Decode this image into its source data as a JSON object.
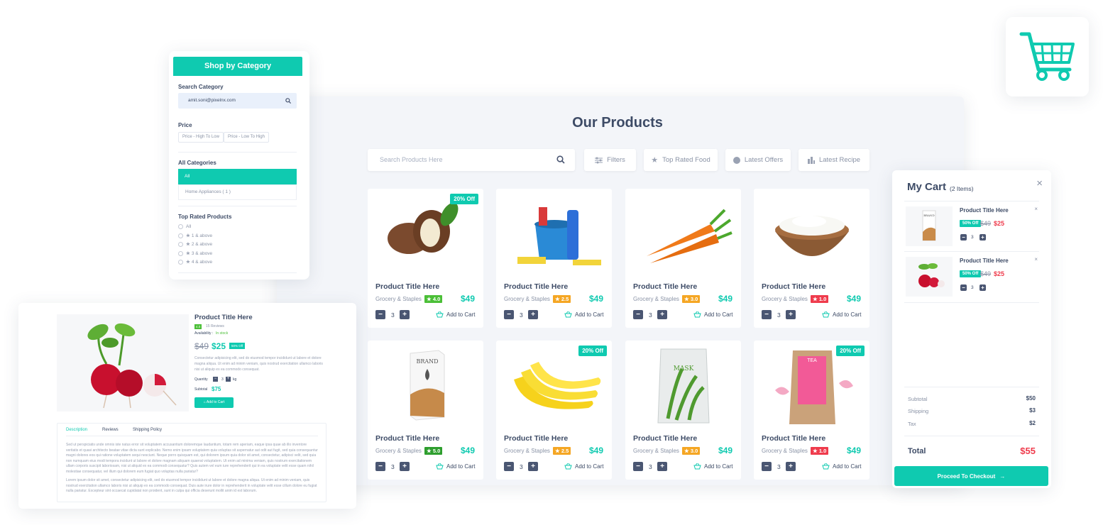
{
  "main": {
    "title": "Our Products",
    "search_placeholder": "Search Products Here",
    "filters": [
      "Filters",
      "Top Rated Food",
      "Latest Offers",
      "Latest Recipe"
    ],
    "products": [
      {
        "title": "Product Title Here",
        "category": "Grocery & Staples",
        "rating": "4.0",
        "price": "$49",
        "qty": "3",
        "add": "Add to Cart",
        "tag": "20% Off",
        "image": "argan-nut",
        "rating_color": "#4bbf37"
      },
      {
        "title": "Product Title Here",
        "category": "Grocery & Staples",
        "rating": "2.5",
        "price": "$49",
        "qty": "3",
        "add": "Add to Cart",
        "tag": "",
        "image": "cleaning-bucket",
        "rating_color": "#f5a623"
      },
      {
        "title": "Product Title Here",
        "category": "Grocery & Staples",
        "rating": "3.0",
        "price": "$49",
        "qty": "3",
        "add": "Add to Cart",
        "tag": "",
        "image": "carrots",
        "rating_color": "#f5a623"
      },
      {
        "title": "Product Title Here",
        "category": "Grocery & Staples",
        "rating": "1.0",
        "price": "$49",
        "qty": "3",
        "add": "Add to Cart",
        "tag": "",
        "image": "yogurt-bowl",
        "rating_color": "#ef3b4c"
      },
      {
        "title": "Product Title Here",
        "category": "Grocery & Staples",
        "rating": "5.0",
        "price": "$49",
        "qty": "3",
        "add": "Add to Cart",
        "tag": "",
        "image": "brand-box",
        "rating_color": "#2e9e2e"
      },
      {
        "title": "Product Title Here",
        "category": "Grocery & Staples",
        "rating": "2.5",
        "price": "$49",
        "qty": "3",
        "add": "Add to Cart",
        "tag": "20% Off",
        "image": "bananas",
        "rating_color": "#f5a623"
      },
      {
        "title": "Product Title Here",
        "category": "Grocery & Staples",
        "rating": "3.0",
        "price": "$49",
        "qty": "3",
        "add": "Add to Cart",
        "tag": "",
        "image": "aloe-mask",
        "rating_color": "#f5a623"
      },
      {
        "title": "Product Title Here",
        "category": "Grocery & Staples",
        "rating": "1.0",
        "price": "$49",
        "qty": "3",
        "add": "Add to Cart",
        "tag": "20% Off",
        "image": "tea-bag",
        "rating_color": "#ef3b4c"
      }
    ]
  },
  "sidebar": {
    "title": "Shop by Category",
    "search_label": "Search Category",
    "search_value": "amit.soni@pixelnx.com",
    "price_label": "Price",
    "price_options": [
      "Price - High To Low",
      "Price - Low To High"
    ],
    "categories_label": "All Categories",
    "categories": [
      "All",
      "Home Appliances ( 1 )"
    ],
    "rated_label": "Top Rated Products",
    "rated_options": [
      "All",
      "1 & above",
      "2 & above",
      "3 & above",
      "4 & above"
    ]
  },
  "detail": {
    "title": "Product Title Here",
    "rating": "4.0",
    "reviews": "15 Reviews",
    "availability_label": "Availability :",
    "availability": "In stock",
    "old_price": "$49",
    "new_price": "$25",
    "badge": "50% Off",
    "description": "Consectetur adipisicing elit, sed do eiusmod tempor incididunt ut labore et dolore magna aliqua. Ut enim ad minim veniam, quis nostrud exercitation ullamco laboris nisi ut aliquip ex ea commodo consequat.",
    "quantity_label": "Quantity",
    "qty": "3",
    "unit": "kg",
    "subtotal_label": "Subtotal",
    "subtotal": "$75",
    "add": "Add to Cart",
    "tabs": [
      "Description",
      "Reviews",
      "Shipping Policy"
    ],
    "text1": "Sed ut perspiciatis unde omnis iste natus error sit voluptatem accusantium doloremque laudantium, totam rem aperiam, eaque ipsa quae ab illo inventore veritatis et quasi architecto beatae vitae dicta sunt explicabo. Nemo enim ipsam voluptatem quia voluptas sit aspernatur aut odit aut fugit, sed quia consequuntur magni dolores eos qui ratione voluptatem sequi nesciunt. Neque porro quisquam est, qui dolorem ipsum quia dolor sit amet, consectetur, adipisci velit, sed quia non numquam eius modi tempora incidunt ut labore et dolore magnam aliquam quaerat voluptatem. Ut enim ad minima veniam, quis nostrum exercitationem ullam corporis suscipit laboriosam, nisi ut aliquid ex ea commodi consequatur? Quis autem vel eum iure reprehenderit qui in ea voluptate velit esse quam nihil molestiae consequatur, vel illum qui dolorem eum fugiat quo voluptas nulla pariatur?",
    "text2": "Lorem ipsum dolor sit amet, consectetur adipisicing elit, sed do eiusmod tempor incididunt ut labore et dolore magna aliqua. Ut enim ad minim veniam, quis nostrud exercitation ullamco laboris nisi ut aliquip ex ea commodo consequat. Duis aute irure dolor in reprehenderit in voluptate velit esse cillum dolore eu fugiat nulla pariatur. Excepteur sint occaecat cupidatat non proident, sunt in culpa qui officia deserunt mollit anim id est laborum."
  },
  "cart": {
    "title": "My Cart",
    "count": "(2 Items)",
    "items": [
      {
        "title": "Product Title Here",
        "badge": "50% Off",
        "old": "$49",
        "new": "$25",
        "qty": "3",
        "image": "brand-box"
      },
      {
        "title": "Product Title Here",
        "badge": "50% Off",
        "old": "$49",
        "new": "$25",
        "qty": "3",
        "image": "radish"
      }
    ],
    "subtotal_label": "Subtotal",
    "subtotal": "$50",
    "shipping_label": "Shipping",
    "shipping": "$3",
    "tax_label": "Tax",
    "tax": "$2",
    "total_label": "Total",
    "total": "$55",
    "checkout": "Proceed To Checkout"
  },
  "colors": {
    "accent": "#0fcab0",
    "danger": "#ef3b4c",
    "text": "#3d4b66"
  }
}
